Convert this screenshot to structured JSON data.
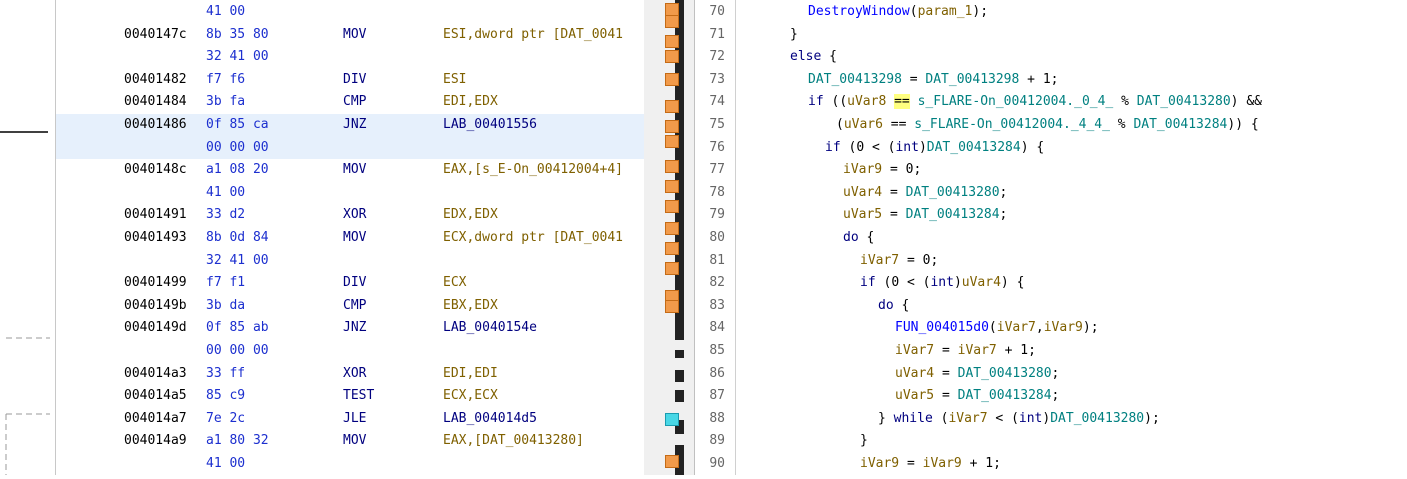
{
  "listing": {
    "rows": [
      {
        "addr": "",
        "bytes": "41 00",
        "mnem": "",
        "ops": ""
      },
      {
        "addr": "0040147c",
        "bytes": "8b 35 80",
        "mnem": "MOV",
        "ops": "ESI,dword ptr [DAT_0041"
      },
      {
        "addr": "",
        "bytes": "32 41 00",
        "mnem": "",
        "ops": ""
      },
      {
        "addr": "00401482",
        "bytes": "f7 f6",
        "mnem": "DIV",
        "ops": "ESI"
      },
      {
        "addr": "00401484",
        "bytes": "3b fa",
        "mnem": "CMP",
        "ops": "EDI,EDX"
      },
      {
        "addr": "00401486",
        "bytes": "0f 85 ca",
        "mnem": "JNZ",
        "ops": "LAB_00401556"
      },
      {
        "addr": "",
        "bytes": "00 00 00",
        "mnem": "",
        "ops": ""
      },
      {
        "addr": "0040148c",
        "bytes": "a1 08 20",
        "mnem": "MOV",
        "ops": "EAX,[s_E-On_00412004+4]"
      },
      {
        "addr": "",
        "bytes": "41 00",
        "mnem": "",
        "ops": ""
      },
      {
        "addr": "00401491",
        "bytes": "33 d2",
        "mnem": "XOR",
        "ops": "EDX,EDX"
      },
      {
        "addr": "00401493",
        "bytes": "8b 0d 84",
        "mnem": "MOV",
        "ops": "ECX,dword ptr [DAT_0041"
      },
      {
        "addr": "",
        "bytes": "32 41 00",
        "mnem": "",
        "ops": ""
      },
      {
        "addr": "00401499",
        "bytes": "f7 f1",
        "mnem": "DIV",
        "ops": "ECX"
      },
      {
        "addr": "0040149b",
        "bytes": "3b da",
        "mnem": "CMP",
        "ops": "EBX,EDX"
      },
      {
        "addr": "0040149d",
        "bytes": "0f 85 ab",
        "mnem": "JNZ",
        "ops": "LAB_0040154e"
      },
      {
        "addr": "",
        "bytes": "00 00 00",
        "mnem": "",
        "ops": ""
      },
      {
        "addr": "004014a3",
        "bytes": "33 ff",
        "mnem": "XOR",
        "ops": "EDI,EDI"
      },
      {
        "addr": "004014a5",
        "bytes": "85 c9",
        "mnem": "TEST",
        "ops": "ECX,ECX"
      },
      {
        "addr": "004014a7",
        "bytes": "7e 2c",
        "mnem": "JLE",
        "ops": "LAB_004014d5"
      },
      {
        "addr": "004014a9",
        "bytes": "a1 80 32",
        "mnem": "MOV",
        "ops": "EAX,[DAT_00413280]"
      },
      {
        "addr": "",
        "bytes": "41 00",
        "mnem": "",
        "ops": ""
      }
    ]
  },
  "decompiler": {
    "lines": [
      {
        "n": "70",
        "t": "DestroyWindow(param_1);"
      },
      {
        "n": "71",
        "t": "}"
      },
      {
        "n": "72",
        "t": "else {"
      },
      {
        "n": "73",
        "t": "DAT_00413298 = DAT_00413298 + 1;"
      },
      {
        "n": "74",
        "t": "if ((uVar8 == s_FLARE-On_00412004._0_4_ % DAT_00413280) &&"
      },
      {
        "n": "75",
        "t": "(uVar6 == s_FLARE-On_00412004._4_4_ % DAT_00413284)) {"
      },
      {
        "n": "76",
        "t": "if (0 < (int)DAT_00413284) {"
      },
      {
        "n": "77",
        "t": "iVar9 = 0;"
      },
      {
        "n": "78",
        "t": "uVar4 = DAT_00413280;"
      },
      {
        "n": "79",
        "t": "uVar5 = DAT_00413284;"
      },
      {
        "n": "80",
        "t": "do {"
      },
      {
        "n": "81",
        "t": "iVar7 = 0;"
      },
      {
        "n": "82",
        "t": "if (0 < (int)uVar4) {"
      },
      {
        "n": "83",
        "t": "do {"
      },
      {
        "n": "84",
        "t": "FUN_004015d0(iVar7,iVar9);"
      },
      {
        "n": "85",
        "t": "iVar7 = iVar7 + 1;"
      },
      {
        "n": "86",
        "t": "uVar4 = DAT_00413280;"
      },
      {
        "n": "87",
        "t": "uVar5 = DAT_00413284;"
      },
      {
        "n": "88",
        "t": "} while (iVar7 < (int)DAT_00413280);"
      },
      {
        "n": "89",
        "t": "}"
      },
      {
        "n": "90",
        "t": "iVar9 = iVar9 + 1;"
      }
    ]
  },
  "colors": {
    "address": "#000000",
    "bytes": "#1c2fcf",
    "mnemonic": "#00007f",
    "operand": "#7f6000",
    "function": "#0000ff",
    "global": "#008080",
    "highlight_row": "#e6f0fc",
    "overview_marker": "#f19a4a",
    "overview_cursor": "#48d7e6"
  },
  "icons": {
    "overview_marker": "orange-block-marker",
    "overview_cursor": "cyan-cursor-marker"
  }
}
